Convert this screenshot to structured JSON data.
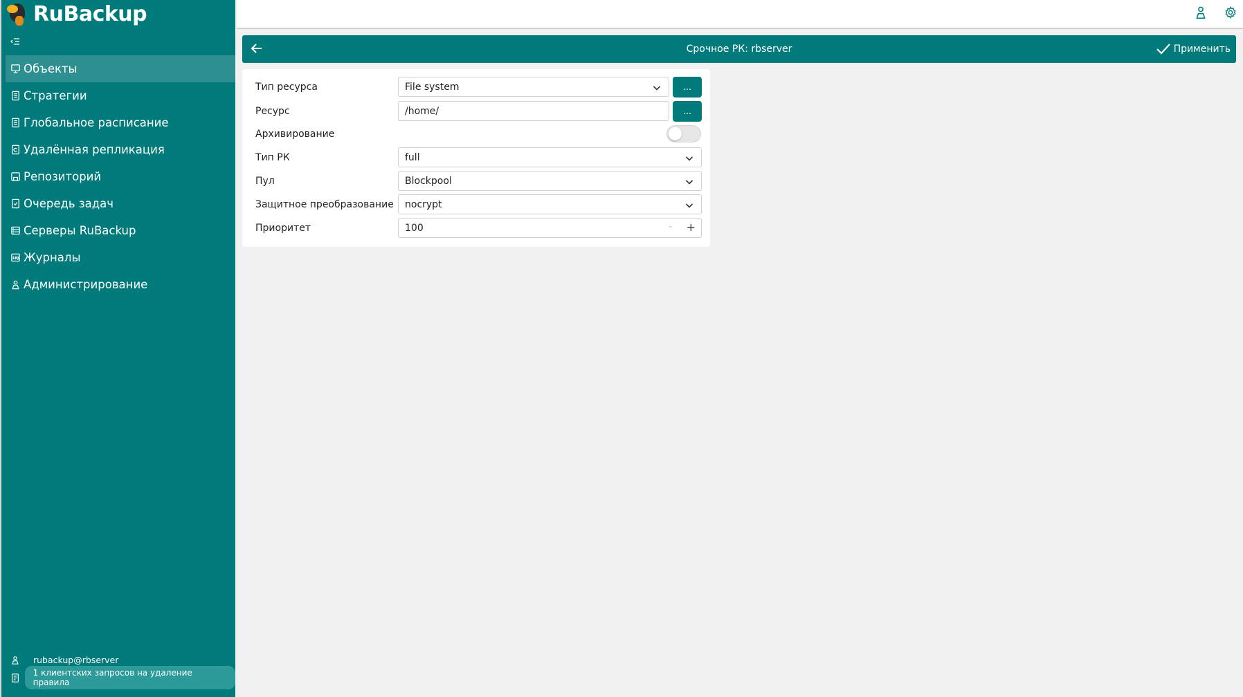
{
  "app": {
    "logo_text": "RuBackup",
    "accent_color": "#007a7a"
  },
  "sidebar": {
    "items": [
      {
        "label": "Объекты",
        "icon": "monitor-icon",
        "active": true
      },
      {
        "label": "Стратегии",
        "icon": "document-icon",
        "active": false
      },
      {
        "label": "Глобальное расписание",
        "icon": "document-icon",
        "active": false
      },
      {
        "label": "Удалённая репликация",
        "icon": "replication-icon",
        "active": false
      },
      {
        "label": "Репозиторий",
        "icon": "repository-icon",
        "active": false
      },
      {
        "label": "Очередь задач",
        "icon": "task-queue-icon",
        "active": false
      },
      {
        "label": "Серверы RuBackup",
        "icon": "server-icon",
        "active": false
      },
      {
        "label": "Журналы",
        "icon": "log-icon",
        "active": false
      },
      {
        "label": "Администрирование",
        "icon": "user-admin-icon",
        "active": false
      }
    ],
    "footer": {
      "user": "rubackup@rbserver",
      "notification": "1 клиентских запросов на удаление правила"
    }
  },
  "header": {
    "title": "Срочное РК: rbserver",
    "apply_label": "Применить"
  },
  "form": {
    "resource_type": {
      "label": "Тип ресурса",
      "value": "File system",
      "button": "..."
    },
    "resource": {
      "label": "Ресурс",
      "value": "/home/",
      "button": "..."
    },
    "archiving": {
      "label": "Архивирование",
      "enabled": false
    },
    "backup_type": {
      "label": "Тип РК",
      "value": "full"
    },
    "pool": {
      "label": "Пул",
      "value": "Blockpool"
    },
    "protection": {
      "label": "Защитное преобразование",
      "value": "nocrypt"
    },
    "priority": {
      "label": "Приоритет",
      "value": "100",
      "minus": "-",
      "plus": "+"
    }
  }
}
